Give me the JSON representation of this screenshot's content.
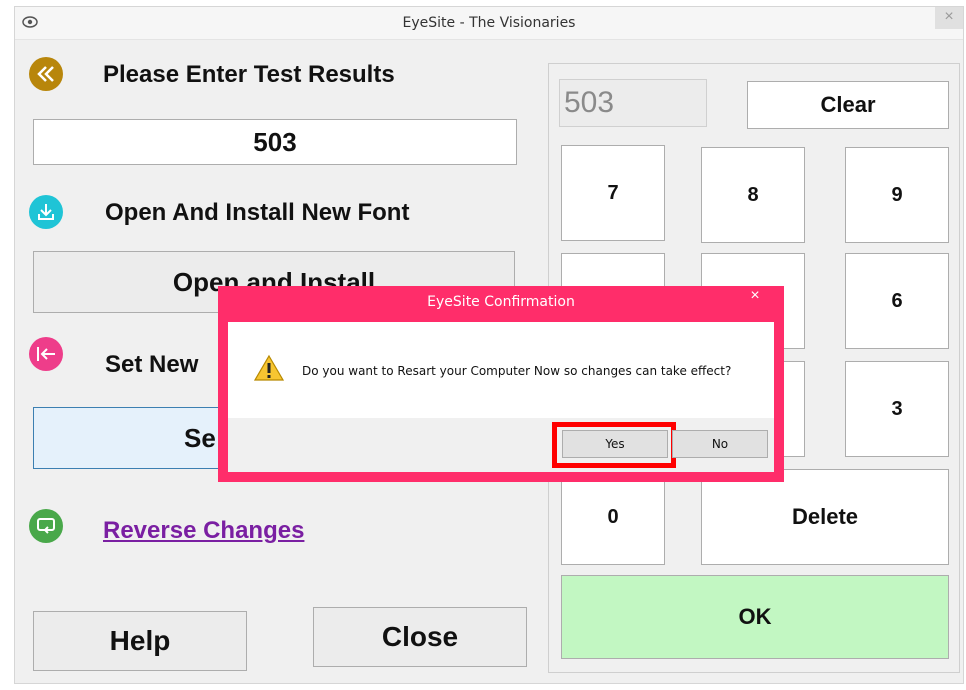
{
  "window": {
    "title": "EyeSite - The Visionaries",
    "app_icon": "eye-icon",
    "close_icon": "close-icon",
    "close_glyph": "×"
  },
  "left_panel": {
    "enter_results_label": "Please Enter Test Results",
    "results_value": "503",
    "install_font_label": "Open And Install New Font",
    "open_install_button": "Open and Install",
    "set_new_label": "Set New",
    "set_button": "Se",
    "reverse_changes_link": "Reverse Changes",
    "help_button": "Help",
    "close_button": "Close"
  },
  "keypad": {
    "display_value": "503",
    "clear_button": "Clear",
    "keys": [
      "7",
      "8",
      "9",
      "6",
      "3",
      "0"
    ],
    "delete_button": "Delete",
    "ok_button": "OK"
  },
  "dialog": {
    "title": "EyeSite Confirmation",
    "close_glyph": "×",
    "message": "Do you want to Resart  your Computer Now so changes can take effect?",
    "yes_button": "Yes",
    "no_button": "No"
  },
  "colors": {
    "back_icon": "#b8860b",
    "download_icon": "#1fc4d6",
    "set_icon": "#ee3d8a",
    "reverse_icon": "#49a84a",
    "dialog_frame": "#ff2d6a",
    "highlight": "#ff0000",
    "ok_button": "#c2f7c2",
    "link": "#7a1fa2"
  }
}
